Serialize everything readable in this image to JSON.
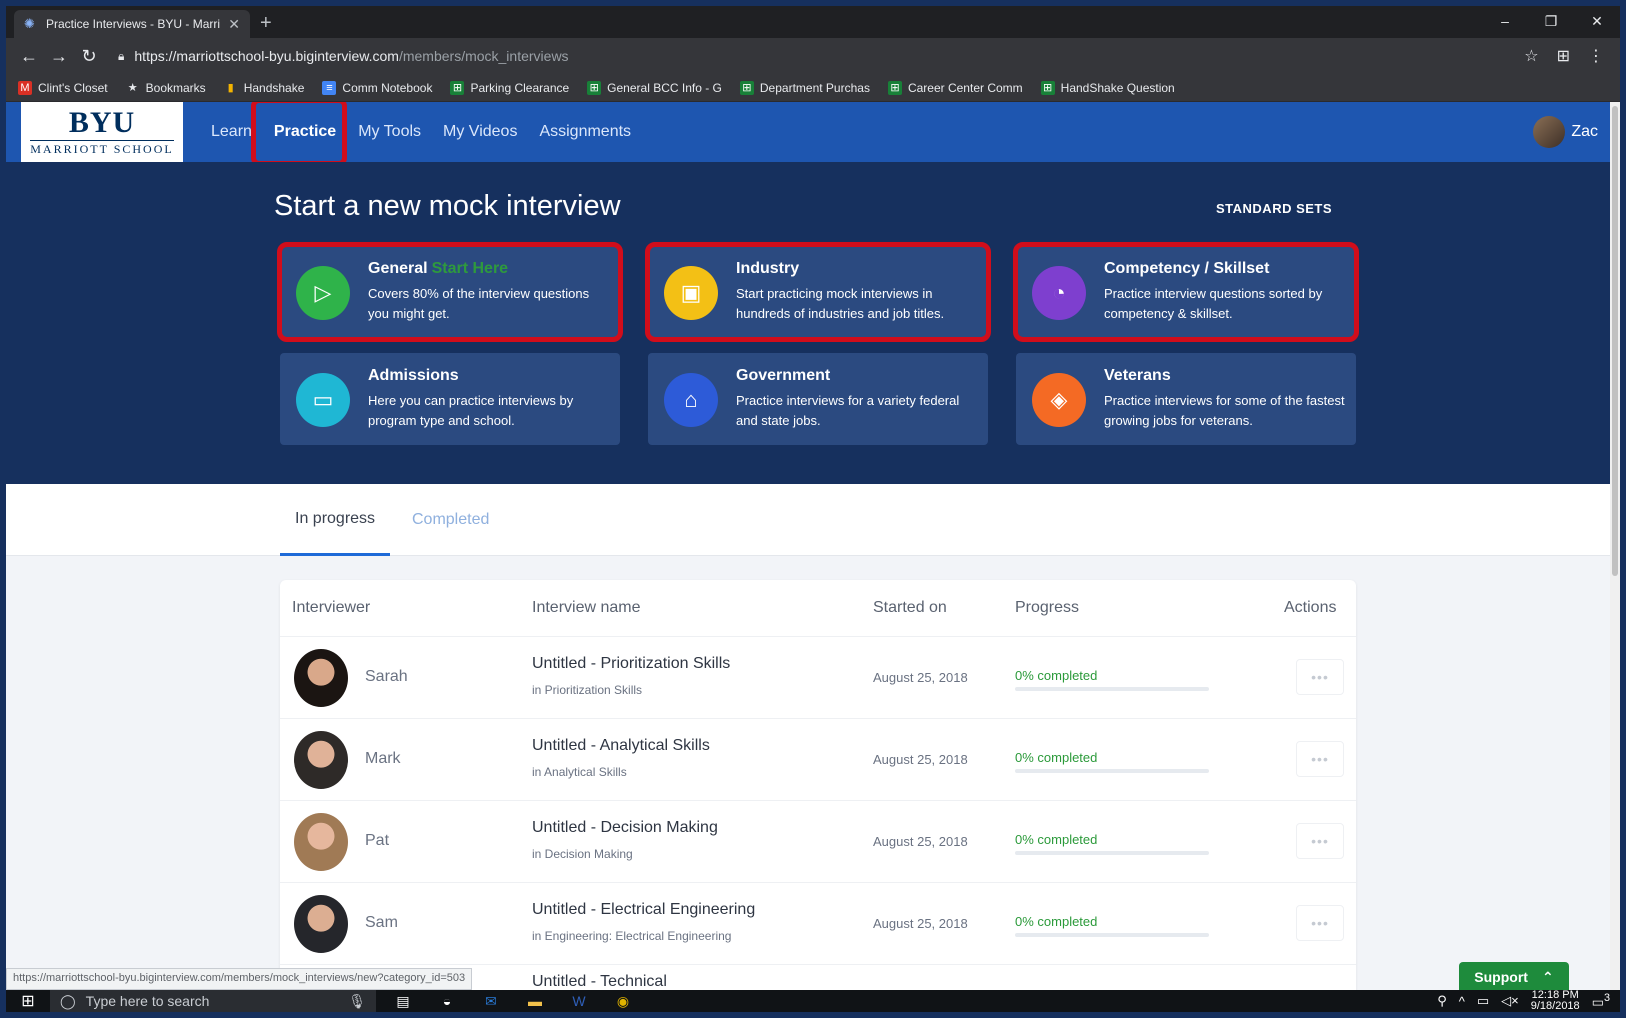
{
  "browser": {
    "tab_title": "Practice Interviews - BYU - Marri",
    "new_tab": "+",
    "window_controls": [
      "–",
      "❐",
      "✕"
    ],
    "url_host": "https://marriottschool-byu.biginterview.com",
    "url_path": "/members/mock_interviews",
    "bookmarks": [
      {
        "label": "Clint's Closet",
        "icon": "red-square-icon"
      },
      {
        "label": "Bookmarks",
        "icon": "star-icon"
      },
      {
        "label": "Handshake",
        "icon": "handshake-icon"
      },
      {
        "label": "Comm Notebook",
        "icon": "doc-icon"
      },
      {
        "label": "Parking Clearance",
        "icon": "sheet-icon"
      },
      {
        "label": "General BCC Info - G",
        "icon": "sheet-icon"
      },
      {
        "label": "Department Purchas",
        "icon": "sheet-icon"
      },
      {
        "label": "Career Center Comm",
        "icon": "sheet-icon"
      },
      {
        "label": "HandShake Question",
        "icon": "sheet-icon"
      }
    ],
    "status_url": "https://marriottschool-byu.biginterview.com/members/mock_interviews/new?category_id=503"
  },
  "nav": {
    "logo_main": "BYU",
    "logo_sub": "MARRIOTT SCHOOL",
    "links": [
      "Learn",
      "Practice",
      "My Tools",
      "My Videos",
      "Assignments"
    ],
    "active": "Practice",
    "user": "Zac"
  },
  "hero": {
    "title": "Start a new mock interview",
    "standard_sets": "STANDARD SETS",
    "cards": [
      {
        "title": "General",
        "tag": "Start Here",
        "desc": "Covers 80% of the interview questions you might get.",
        "color": "#2fb34a",
        "icon": "▷"
      },
      {
        "title": "Industry",
        "tag": "",
        "desc": "Start practicing mock interviews in hundreds of industries and job titles.",
        "color": "#f3c015",
        "icon": "▣"
      },
      {
        "title": "Competency / Skillset",
        "tag": "",
        "desc": "Practice interview questions sorted by competency & skillset.",
        "color": "#7e3fcf",
        "icon": "◔"
      },
      {
        "title": "Admissions",
        "tag": "",
        "desc": "Here you can practice interviews by program type and school.",
        "color": "#1fb7d4",
        "icon": "▭"
      },
      {
        "title": "Government",
        "tag": "",
        "desc": "Practice interviews for a variety federal and state jobs.",
        "color": "#2d5bd8",
        "icon": "⌂"
      },
      {
        "title": "Veterans",
        "tag": "",
        "desc": "Practice interviews for some of the fastest growing jobs for veterans.",
        "color": "#f46a24",
        "icon": "◈"
      }
    ]
  },
  "tabs": {
    "in_progress": "In progress",
    "completed": "Completed"
  },
  "table": {
    "headers": [
      "Interviewer",
      "Interview name",
      "Started on",
      "Progress",
      "Actions"
    ],
    "rows": [
      {
        "interviewer": "Sarah",
        "name": "Untitled - Prioritization Skills",
        "category": "in Prioritization Skills",
        "started": "August 25, 2018",
        "progress": "0% completed",
        "progress_value": 0,
        "action": "•••"
      },
      {
        "interviewer": "Mark",
        "name": "Untitled - Analytical Skills",
        "category": "in Analytical Skills",
        "started": "August 25, 2018",
        "progress": "0% completed",
        "progress_value": 0,
        "action": "•••"
      },
      {
        "interviewer": "Pat",
        "name": "Untitled - Decision Making",
        "category": "in Decision Making",
        "started": "August 25, 2018",
        "progress": "0% completed",
        "progress_value": 0,
        "action": "•••"
      },
      {
        "interviewer": "Sam",
        "name": "Untitled - Electrical Engineering",
        "category": "in Engineering: Electrical Engineering",
        "started": "August 25, 2018",
        "progress": "0% completed",
        "progress_value": 0,
        "action": "•••"
      }
    ],
    "partial_row_name": "Untitled - Technical"
  },
  "support": {
    "label": "Support"
  },
  "taskbar": {
    "search_placeholder": "Type here to search",
    "time": "12:18 PM",
    "date": "9/18/2018",
    "notifications": "3"
  }
}
